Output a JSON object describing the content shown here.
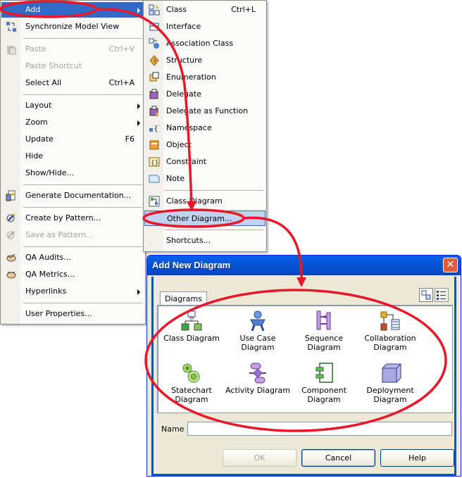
{
  "context_menu": {
    "items": [
      {
        "label": "Add",
        "shortcut": "",
        "submenu": true,
        "disabled": false,
        "selected": true
      },
      {
        "label": "Synchronize Model View",
        "shortcut": "",
        "submenu": false,
        "disabled": false
      },
      {
        "label": "Paste",
        "shortcut": "Ctrl+V",
        "submenu": false,
        "disabled": true
      },
      {
        "label": "Paste Shortcut",
        "shortcut": "",
        "submenu": false,
        "disabled": true
      },
      {
        "label": "Select All",
        "shortcut": "Ctrl+A",
        "submenu": false,
        "disabled": false
      },
      {
        "label": "Layout",
        "shortcut": "",
        "submenu": true,
        "disabled": false
      },
      {
        "label": "Zoom",
        "shortcut": "",
        "submenu": true,
        "disabled": false
      },
      {
        "label": "Update",
        "shortcut": "F6",
        "submenu": false,
        "disabled": false
      },
      {
        "label": "Hide",
        "shortcut": "",
        "submenu": false,
        "disabled": false
      },
      {
        "label": "Show/Hide...",
        "shortcut": "",
        "submenu": false,
        "disabled": false
      },
      {
        "label": "Generate Documentation...",
        "shortcut": "",
        "submenu": false,
        "disabled": false
      },
      {
        "label": "Create by Pattern...",
        "shortcut": "",
        "submenu": false,
        "disabled": false
      },
      {
        "label": "Save as Pattern...",
        "shortcut": "",
        "submenu": false,
        "disabled": true
      },
      {
        "label": "QA Audits...",
        "shortcut": "",
        "submenu": false,
        "disabled": false
      },
      {
        "label": "QA Metrics...",
        "shortcut": "",
        "submenu": false,
        "disabled": false
      },
      {
        "label": "Hyperlinks",
        "shortcut": "",
        "submenu": true,
        "disabled": false
      },
      {
        "label": "User Properties...",
        "shortcut": "",
        "submenu": false,
        "disabled": false
      }
    ]
  },
  "add_submenu": {
    "items": [
      {
        "label": "Class",
        "shortcut": "Ctrl+L"
      },
      {
        "label": "Interface",
        "shortcut": ""
      },
      {
        "label": "Association Class",
        "shortcut": ""
      },
      {
        "label": "Structure",
        "shortcut": ""
      },
      {
        "label": "Enumeration",
        "shortcut": ""
      },
      {
        "label": "Delegate",
        "shortcut": ""
      },
      {
        "label": "Delegate as Function",
        "shortcut": ""
      },
      {
        "label": "Namespace",
        "shortcut": ""
      },
      {
        "label": "Object",
        "shortcut": ""
      },
      {
        "label": "Constraint",
        "shortcut": ""
      },
      {
        "label": "Note",
        "shortcut": ""
      },
      {
        "label": "Class Diagram",
        "shortcut": ""
      },
      {
        "label": "Other Diagram...",
        "shortcut": ""
      },
      {
        "label": "Shortcuts...",
        "shortcut": ""
      }
    ]
  },
  "dialog": {
    "title": "Add New Diagram",
    "close_label": "✕",
    "tab_label": "Diagrams",
    "diagram_types": [
      {
        "label": "Class Diagram"
      },
      {
        "label": "Use Case Diagram"
      },
      {
        "label": "Sequence Diagram"
      },
      {
        "label": "Collaboration Diagram"
      },
      {
        "label": "Statechart Diagram"
      },
      {
        "label": "Activity Diagram"
      },
      {
        "label": "Component Diagram"
      },
      {
        "label": "Deployment Diagram"
      }
    ],
    "name_label": "Name",
    "name_value": "",
    "ok_label": "OK",
    "cancel_label": "Cancel",
    "help_label": "Help"
  },
  "colors": {
    "menu_highlight": "#316ac5",
    "annotation_red": "#e8182a",
    "dialog_titlebar": "#0554d5"
  }
}
